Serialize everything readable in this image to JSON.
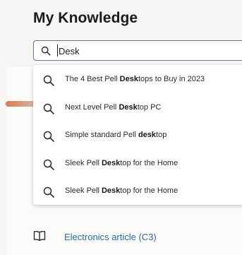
{
  "page": {
    "title": "My Knowledge"
  },
  "search": {
    "value": "Desk"
  },
  "suggestions": [
    {
      "before": "The 4 Best Pell ",
      "match": "Desk",
      "after": "tops to Buy in 2023"
    },
    {
      "before": "Next Level Pell ",
      "match": "Desk",
      "after": "top PC"
    },
    {
      "before": "Simple standard Pell ",
      "match": "desk",
      "after": "top"
    },
    {
      "before": "Sleek Pell ",
      "match": "Desk",
      "after": "top for the Home"
    },
    {
      "before": "Sleek Pell ",
      "match": "Desk",
      "after": "top for the Home"
    }
  ],
  "article": {
    "label": "Electronics article (C3)",
    "icon": "book-icon"
  },
  "icons": {
    "search": "search-icon",
    "suggestion": "search-icon"
  },
  "colors": {
    "accent": "#e07a4a",
    "link": "#2a6aa6",
    "focus_border": "#5a7a96"
  }
}
